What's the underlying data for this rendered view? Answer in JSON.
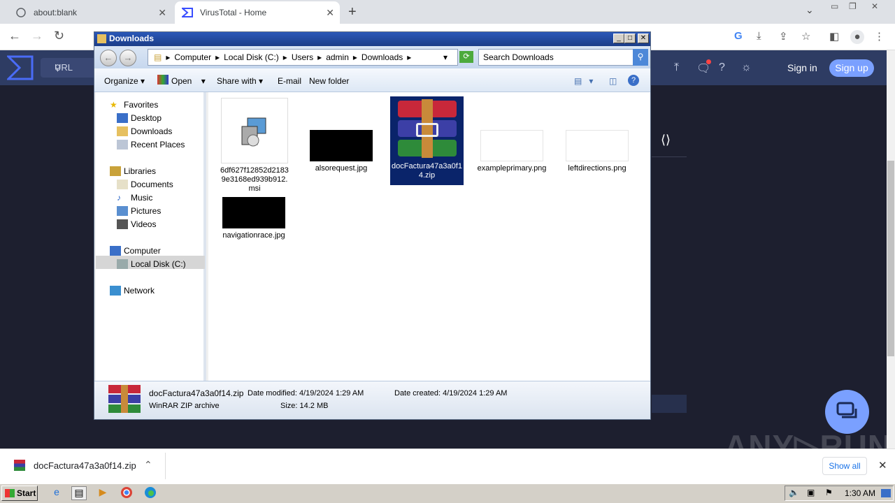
{
  "browser": {
    "tabs": [
      {
        "title": "about:blank"
      },
      {
        "title": "VirusTotal - Home"
      }
    ],
    "new_tab": "+",
    "close": "✕",
    "back": "←",
    "forward": "→",
    "reload": "↻"
  },
  "virustotal": {
    "search_placeholder": "URL",
    "sign_in": "Sign in",
    "sign_up": "Sign up",
    "brand_color": "#7aa0ff"
  },
  "explorer": {
    "title": "Downloads",
    "path": [
      "Computer",
      "Local Disk (C:)",
      "Users",
      "admin",
      "Downloads"
    ],
    "search_placeholder": "Search Downloads",
    "commands": [
      "Organize",
      "Open",
      "Share with",
      "E-mail",
      "New folder"
    ],
    "nav": {
      "favorites": "Favorites",
      "desktop": "Desktop",
      "downloads": "Downloads",
      "recent": "Recent Places",
      "libraries": "Libraries",
      "documents": "Documents",
      "music": "Music",
      "pictures": "Pictures",
      "videos": "Videos",
      "computer": "Computer",
      "localdisk": "Local Disk (C:)",
      "network": "Network"
    },
    "files": [
      {
        "name": "6df627f12852d21839e3168ed939b912.msi",
        "icon": "installer-icon"
      },
      {
        "name": "alsorequest.jpg",
        "icon": "image-thumb"
      },
      {
        "name": "docFactura47a3a0f14.zip",
        "icon": "winrar-icon",
        "selected": true
      },
      {
        "name": "exampleprimary.png",
        "icon": "image-thumb"
      },
      {
        "name": "leftdirections.png",
        "icon": "image-thumb"
      },
      {
        "name": "navigationrace.jpg",
        "icon": "image-thumb"
      }
    ],
    "details": {
      "name": "docFactura47a3a0f14.zip",
      "type": "WinRAR ZIP archive",
      "modified": "Date modified: 4/19/2024 1:29 AM",
      "created": "Date created: 4/19/2024 1:29 AM",
      "size": "Size: 14.2 MB"
    }
  },
  "download_bar": {
    "filename": "docFactura47a3a0f14.zip",
    "show_all": "Show all"
  },
  "taskbar": {
    "start": "Start",
    "clock": "1:30 AM"
  }
}
